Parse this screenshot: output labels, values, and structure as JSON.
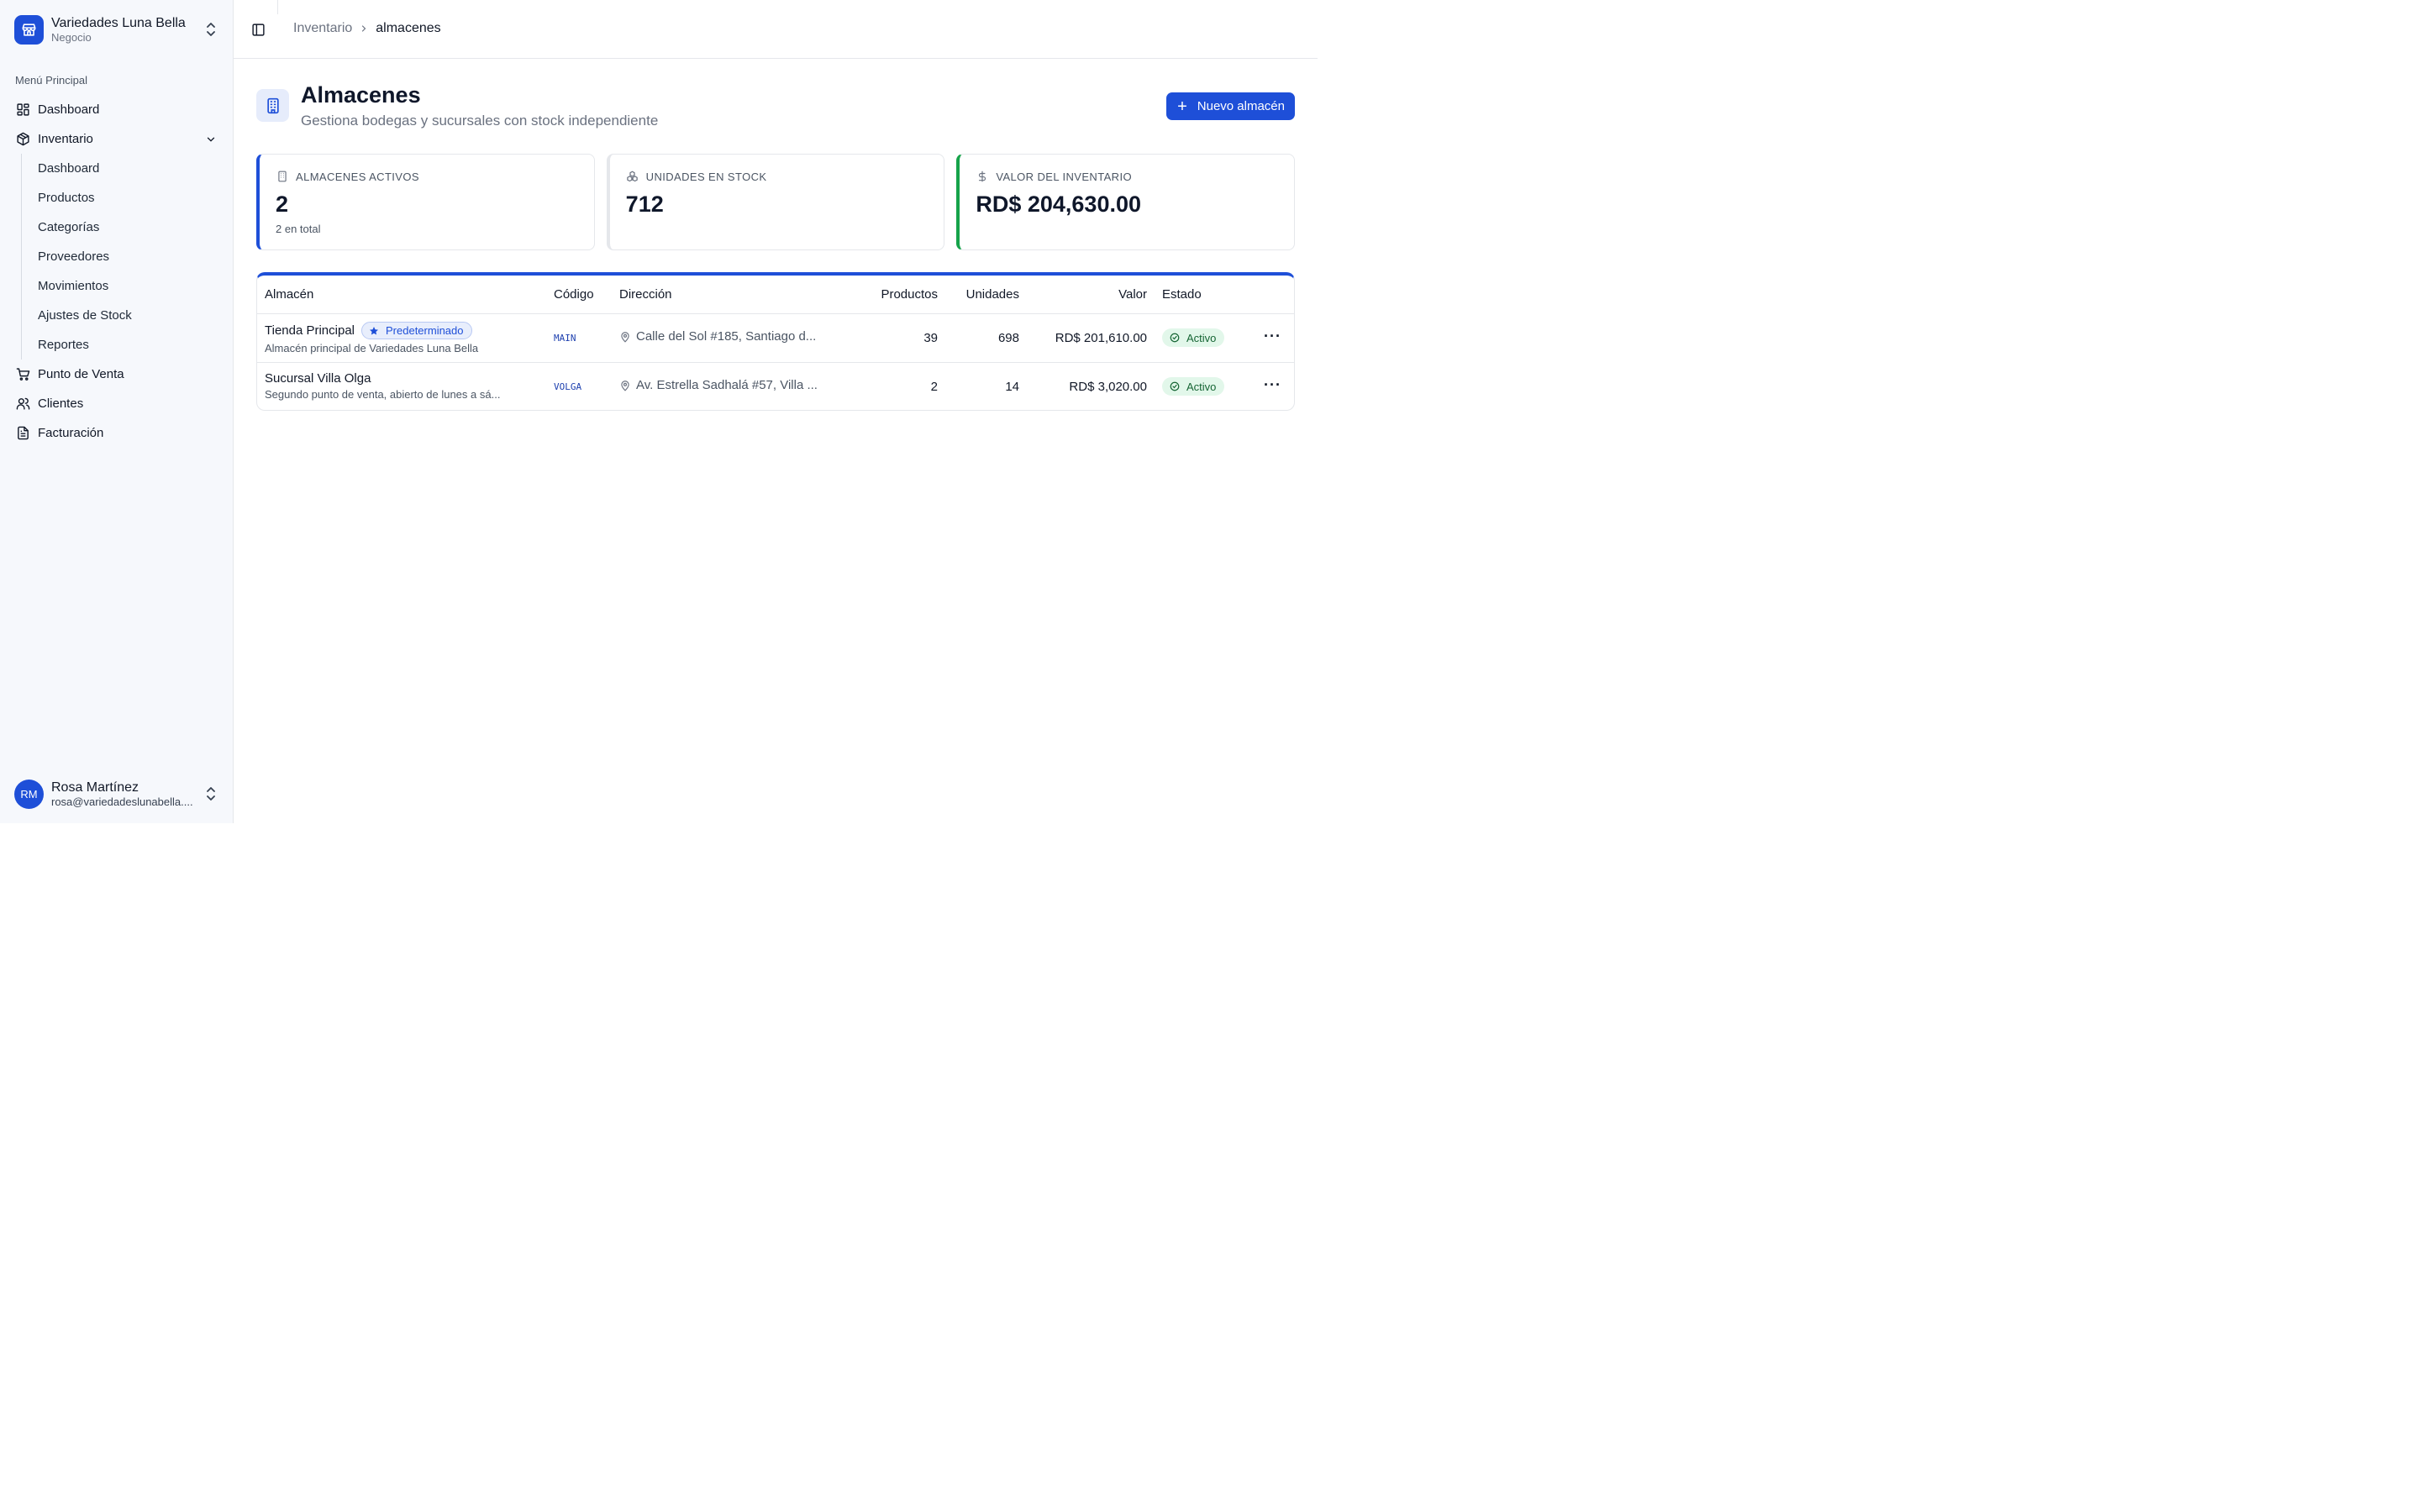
{
  "brand": {
    "name": "Variedades Luna Bella",
    "subtitle": "Negocio"
  },
  "sidebar": {
    "menu_label": "Menú Principal",
    "items": [
      {
        "label": "Dashboard",
        "icon": "layout-grid-icon"
      },
      {
        "label": "Inventario",
        "icon": "package-icon",
        "expanded": true
      },
      {
        "label": "Punto de Venta",
        "icon": "cart-icon"
      },
      {
        "label": "Clientes",
        "icon": "users-icon"
      },
      {
        "label": "Facturación",
        "icon": "file-text-icon"
      }
    ],
    "inventory_sub": [
      "Dashboard",
      "Productos",
      "Categorías",
      "Proveedores",
      "Movimientos",
      "Ajustes de Stock",
      "Reportes"
    ]
  },
  "user": {
    "initials": "RM",
    "name": "Rosa Martínez",
    "email": "rosa@variedadeslunabella...."
  },
  "breadcrumb": {
    "parent": "Inventario",
    "current": "almacenes"
  },
  "page": {
    "title": "Almacenes",
    "subtitle": "Gestiona bodegas y sucursales con stock independiente",
    "new_button": "Nuevo almacén"
  },
  "stats": [
    {
      "label": "ALMACENES ACTIVOS",
      "value": "2",
      "note": "2 en total",
      "accent": "#1e4fd8"
    },
    {
      "label": "UNIDADES EN STOCK",
      "value": "712",
      "note": "",
      "accent": "#e5e7eb"
    },
    {
      "label": "VALOR DEL INVENTARIO",
      "value": "RD$ 204,630.00",
      "note": "",
      "accent": "#16a34a"
    }
  ],
  "table": {
    "headers": {
      "warehouse": "Almacén",
      "code": "Código",
      "address": "Dirección",
      "products": "Productos",
      "units": "Unidades",
      "value": "Valor",
      "status": "Estado"
    },
    "rows": [
      {
        "name": "Tienda Principal",
        "badge": "Predeterminado",
        "description": "Almacén principal de Variedades Luna Bella",
        "code": "MAIN",
        "address": "Calle del Sol #185, Santiago d...",
        "products": "39",
        "units": "698",
        "value": "RD$ 201,610.00",
        "status": "Activo"
      },
      {
        "name": "Sucursal Villa Olga",
        "badge": "",
        "description": "Segundo punto de venta, abierto de lunes a sá...",
        "code": "VOLGA",
        "address": "Av. Estrella Sadhalá #57, Villa ...",
        "products": "2",
        "units": "14",
        "value": "RD$ 3,020.00",
        "status": "Activo"
      }
    ]
  },
  "colors": {
    "primary": "#1e4fd8",
    "success": "#16a34a",
    "sidebar_bg": "#f6f8fc"
  }
}
